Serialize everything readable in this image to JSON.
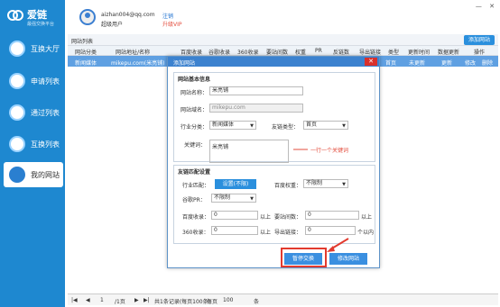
{
  "app": {
    "name": "爱链",
    "slogan": "最强交换平台"
  },
  "nav": [
    {
      "label": "互换大厅"
    },
    {
      "label": "申请列表"
    },
    {
      "label": "通过列表"
    },
    {
      "label": "互换列表"
    },
    {
      "label": "我的网站"
    }
  ],
  "user": {
    "email": "aizhan004@qq.com",
    "role": "超级用户",
    "logout": "注销",
    "upgrade": "升级VIP"
  },
  "window_buttons": [
    "—",
    "✕"
  ],
  "list": {
    "title": "网站列表",
    "add_button": "添加网站"
  },
  "table": {
    "headers": [
      "网站分类",
      "网站地址/名称",
      "百度收录",
      "谷歌收录",
      "360收录",
      "要站间数",
      "权重",
      "PR",
      "反链数",
      "导出链接",
      "类型",
      "更新时间",
      "数据更新",
      "操作"
    ],
    "row": {
      "category": "新闻媒体",
      "site": "mikepu.com(米亮铺)",
      "col_header_partial": "添加网站",
      "type": "首页",
      "updated": "未更新",
      "refresh": "更新",
      "edit": "修改",
      "delete": "删除"
    }
  },
  "modal": {
    "title": "添加网站",
    "close": "✕",
    "basic_section": "网站基本信息",
    "name_label": "网站名称：",
    "name_value": "米亮铺",
    "domain_label": "网站域名：",
    "domain_value": "mikepu.com",
    "industry_label": "行业分类：",
    "industry_value": "新闻媒体",
    "linktype_label": "友链类型：",
    "linktype_value": "首页",
    "keyword_label": "关键词：",
    "keyword_value": "米亮铺",
    "keyword_hint": "一行一个关键词",
    "match_section": "友链匹配设置",
    "industry_match_label": "行业匹配：",
    "industry_match_value": "设置(不限)",
    "baidu_weight_label": "百度权重：",
    "baidu_weight_value": "不限制",
    "google_pr_label": "谷歌PR：",
    "google_pr_value": "不限制",
    "baidu_index_label": "百度收录：",
    "baidu_index_value": "0",
    "baidu_index_suffix": "以上",
    "site_count_label": "要站间数：",
    "site_count_value": "0",
    "site_count_suffix": "以上",
    "so360_label": "360收录：",
    "so360_value": "0",
    "so360_suffix": "以上",
    "export_label": "导出链接：",
    "export_value": "0",
    "export_suffix": "个以内",
    "pause_button": "暂停交换",
    "edit_button": "修改网站"
  },
  "pager": {
    "first": "|◀",
    "prev": "◀",
    "page": "1",
    "total_pages": "/1页",
    "next": "▶",
    "last": "▶|",
    "summary": "共1条记录(每页100条)",
    "per_page_label": "每页",
    "per_page_value": "100",
    "unit": "条"
  }
}
